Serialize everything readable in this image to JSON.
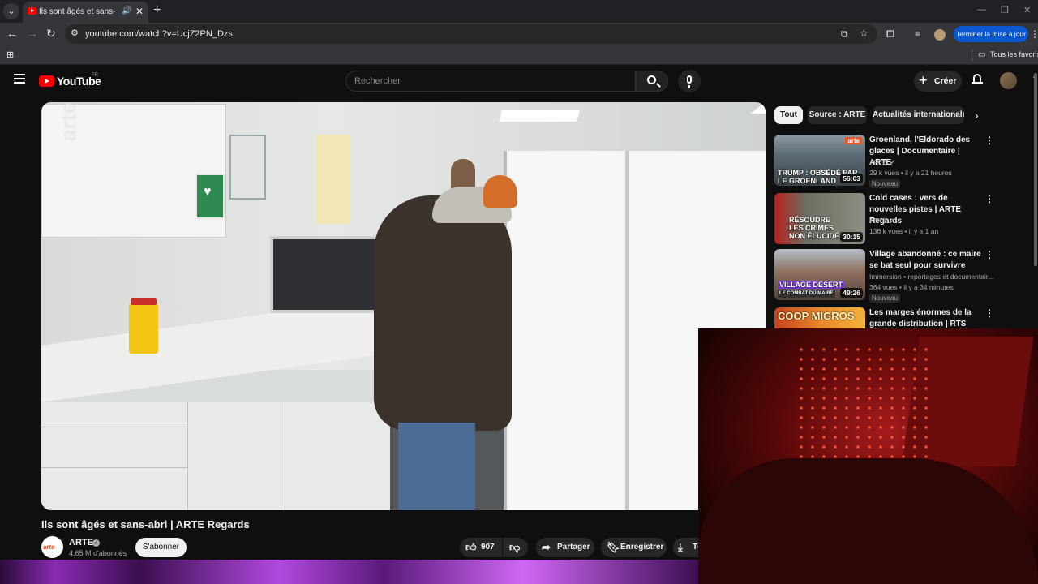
{
  "browser": {
    "tab_title": "Ils sont âgés et sans-abri | ARTE Regards",
    "url": "youtube.com/watch?v=UcjZ2PN_Dzs",
    "update_button": "Terminer la mise à jour",
    "bookmarks_all": "Tous les favoris"
  },
  "masthead": {
    "logo_text": "YouTube",
    "country": "FR",
    "search_placeholder": "Rechercher",
    "create_label": "Créer"
  },
  "video": {
    "title": "Ils sont âgés et sans-abri | ARTE Regards",
    "watermark": "arte",
    "channel": {
      "name": "ARTE",
      "avatar_text": "arte",
      "subscribers": "4,65 M d'abonnés",
      "subscribe_label": "S'abonner"
    },
    "actions": {
      "likes": "907",
      "share": "Partager",
      "save": "Enregistrer",
      "download": "Té"
    }
  },
  "sidebar": {
    "chips": [
      "Tout",
      "Source : ARTE",
      "Actualités internationales"
    ],
    "recommendations": [
      {
        "title": "Groenland, l'Eldorado des glaces | Documentaire | ARTE",
        "channel": "ARTE",
        "verified": true,
        "stats": "29 k vues • il y a 21 heures",
        "badge": "Nouveau",
        "duration": "56:03",
        "thumb_text": "TRUMP : OBSÉDÉ PAR LE GROENLAND",
        "thumb_tag": "arte"
      },
      {
        "title": "Cold cases : vers de nouvelles pistes | ARTE Regards",
        "channel": "ARTE",
        "verified": true,
        "stats": "136 k vues • il y a 1 an",
        "badge": "",
        "duration": "30:15",
        "thumb_text": "RÉSOUDRE LES CRIMES NON ÉLUCIDÉS",
        "thumb_tag": ""
      },
      {
        "title": "Village abandonné : ce maire se bat seul pour survivre",
        "channel": "Immersion",
        "channel_extra": "• reportages et documentair...",
        "verified": false,
        "stats": "364 vues • il y a 34 minutes",
        "badge": "Nouveau",
        "duration": "49:26",
        "thumb_text": "VILLAGE DÉSERT",
        "thumb_sub": "LE COMBAT DU MAIRE",
        "thumb_tag": ""
      },
      {
        "title": "Les marges énormes de la grande distribution | RTS",
        "thumb_text": "COOP MIGROS"
      }
    ]
  }
}
